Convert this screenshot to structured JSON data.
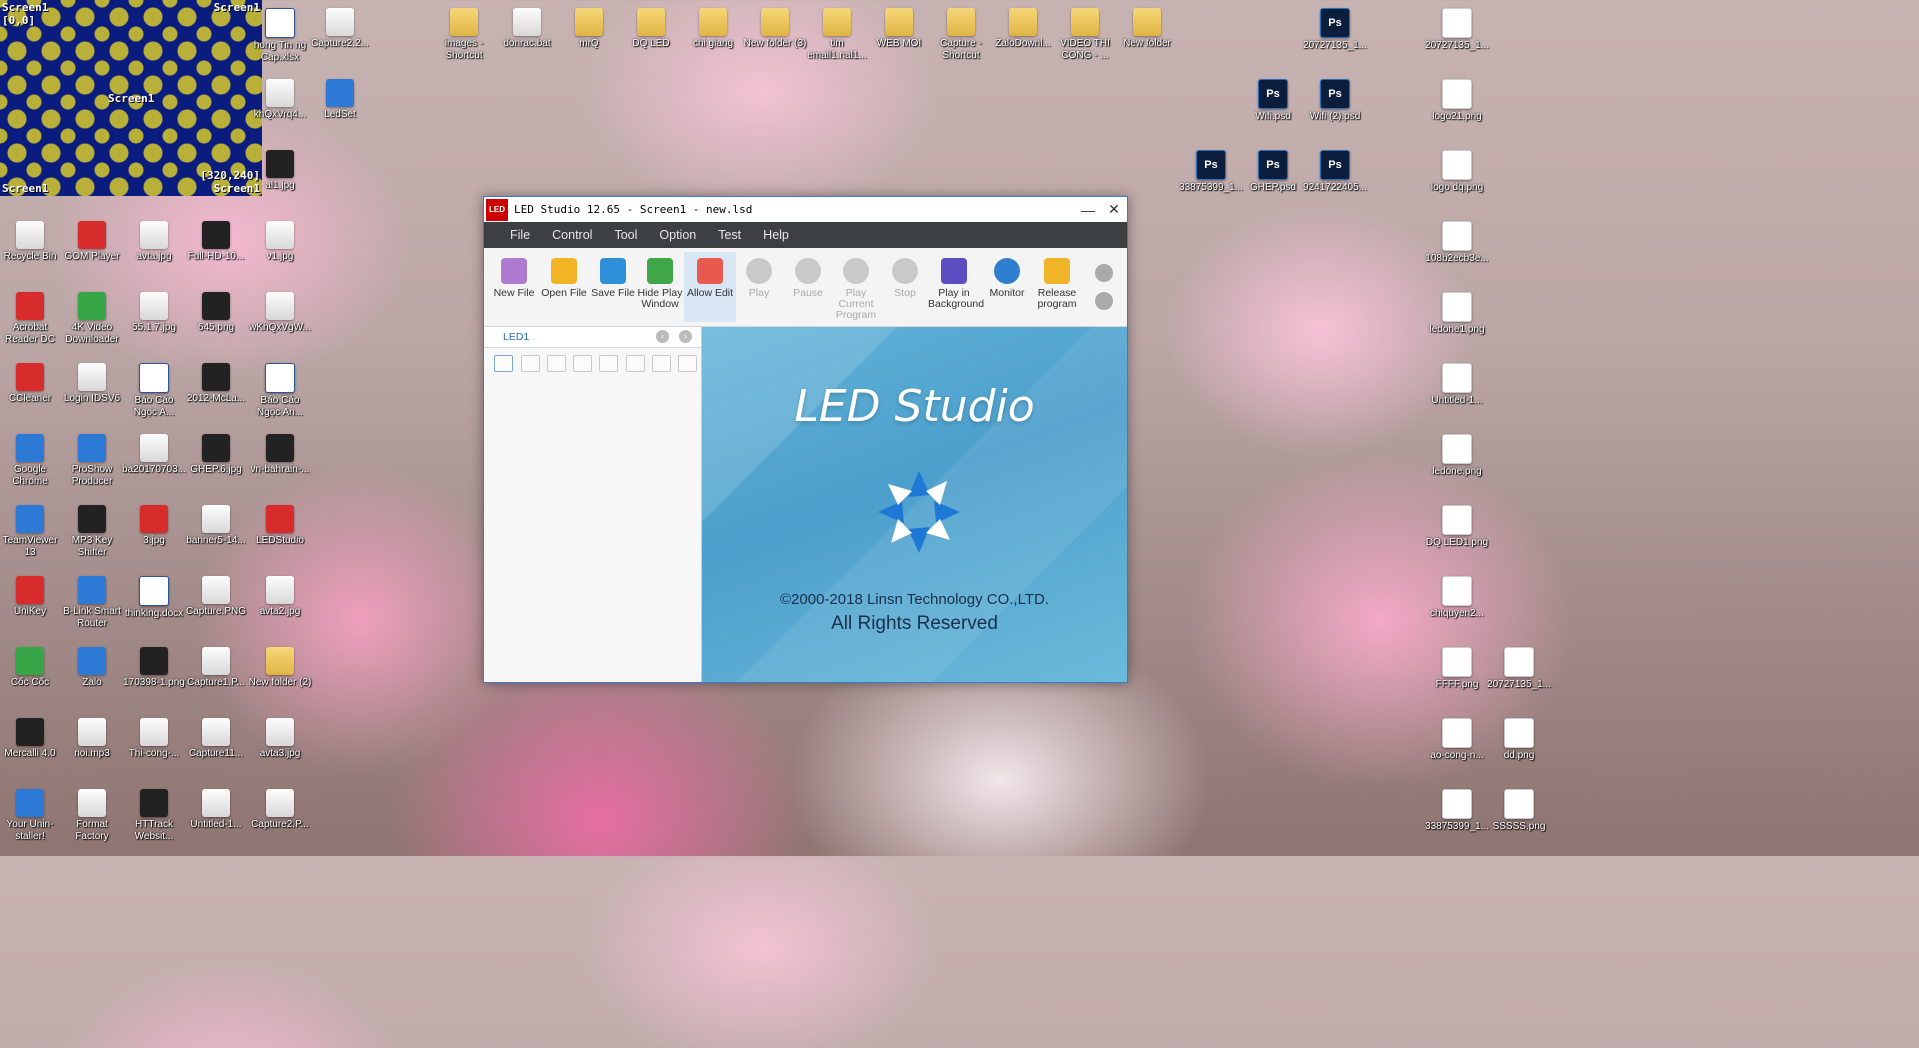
{
  "screen_preview": {
    "top_left": "Screen1",
    "coord_origin": "[0,0]",
    "top_right": "Screen1",
    "center": "Screen1",
    "bottom_left": "Screen1",
    "coord_size": "[320,240]",
    "bottom_right": "Screen1"
  },
  "desktop_icons": [
    {
      "label": "hong Tin ng Cap.xlsx",
      "kind": "doc"
    },
    {
      "label": "Capture2.2...",
      "kind": "img"
    },
    {
      "label": "images - Shortcut",
      "kind": "folder"
    },
    {
      "label": "donrac.bat",
      "kind": "img"
    },
    {
      "label": "mrQ",
      "kind": "folder"
    },
    {
      "label": "DQ LED",
      "kind": "folder"
    },
    {
      "label": "chi giang",
      "kind": "folder"
    },
    {
      "label": "New folder (3)",
      "kind": "folder"
    },
    {
      "label": "tim email1.nal1...",
      "kind": "folder"
    },
    {
      "label": "WEB MOI",
      "kind": "folder"
    },
    {
      "label": "Capture - Shortcut",
      "kind": "folder"
    },
    {
      "label": "ZaloDownl...",
      "kind": "folder"
    },
    {
      "label": "VIDEO THI CONG - ...",
      "kind": "folder"
    },
    {
      "label": "New folder",
      "kind": "folder"
    },
    {
      "label": "20727135_1...",
      "kind": "ps"
    },
    {
      "label": "20727135_1...",
      "kind": "png"
    },
    {
      "label": "khQxVrq4...",
      "kind": "img"
    },
    {
      "label": "LedSet",
      "kind": "app"
    },
    {
      "label": "Wifi.psd",
      "kind": "ps"
    },
    {
      "label": "Wifi (2).psd",
      "kind": "ps"
    },
    {
      "label": "logo21.png",
      "kind": "png"
    },
    {
      "label": "al1.jpg",
      "kind": "dark"
    },
    {
      "label": "33875399_1...",
      "kind": "ps"
    },
    {
      "label": "GHEP.psd",
      "kind": "ps"
    },
    {
      "label": "9241722405...",
      "kind": "ps"
    },
    {
      "label": "logo dq.png",
      "kind": "png"
    },
    {
      "label": "Recycle Bin",
      "kind": "img"
    },
    {
      "label": "GOM Player",
      "kind": "red"
    },
    {
      "label": "avta.jpg",
      "kind": "img"
    },
    {
      "label": "Full-HD-10...",
      "kind": "dark"
    },
    {
      "label": "v1.jpg",
      "kind": "img"
    },
    {
      "label": "108b2ecb3e...",
      "kind": "png"
    },
    {
      "label": "Acrobat Reader DC",
      "kind": "red"
    },
    {
      "label": "4K Video Downloader",
      "kind": "green"
    },
    {
      "label": "55.1.7.jpg",
      "kind": "img"
    },
    {
      "label": "645.png",
      "kind": "dark"
    },
    {
      "label": "wKhQxVgW...",
      "kind": "img"
    },
    {
      "label": "ledone1.png",
      "kind": "png"
    },
    {
      "label": "CCleaner",
      "kind": "red"
    },
    {
      "label": "Login IDSV6",
      "kind": "img"
    },
    {
      "label": "Báo Cáo Ngọc A...",
      "kind": "doc"
    },
    {
      "label": "2012-McLa...",
      "kind": "dark"
    },
    {
      "label": "Báo Cáo Ngọc An...",
      "kind": "doc"
    },
    {
      "label": "Untitled-1...",
      "kind": "png"
    },
    {
      "label": "Google Chrome",
      "kind": "app"
    },
    {
      "label": "ProShow Producer",
      "kind": "app"
    },
    {
      "label": "ba20170703...",
      "kind": "img"
    },
    {
      "label": "GHEP.6.jpg",
      "kind": "dark"
    },
    {
      "label": "vn-bahrain-...",
      "kind": "dark"
    },
    {
      "label": "ledone.png",
      "kind": "png"
    },
    {
      "label": "TeamViewer 13",
      "kind": "app"
    },
    {
      "label": "MP3 Key Shifter",
      "kind": "dark"
    },
    {
      "label": "3.jpg",
      "kind": "red"
    },
    {
      "label": "banner5-14...",
      "kind": "img"
    },
    {
      "label": "LEDStudio",
      "kind": "red"
    },
    {
      "label": "DQ LED1.png",
      "kind": "png"
    },
    {
      "label": "UniKey",
      "kind": "red"
    },
    {
      "label": "B-Link Smart Router",
      "kind": "app"
    },
    {
      "label": "thinking.docx",
      "kind": "doc"
    },
    {
      "label": "Capture.PNG",
      "kind": "img"
    },
    {
      "label": "avta2.jpg",
      "kind": "img"
    },
    {
      "label": "chiquyen2...",
      "kind": "png"
    },
    {
      "label": "Cốc Cốc",
      "kind": "green"
    },
    {
      "label": "Zalo",
      "kind": "app"
    },
    {
      "label": "170398-1.png",
      "kind": "dark"
    },
    {
      "label": "Capture1.P...",
      "kind": "img"
    },
    {
      "label": "New folder (2)",
      "kind": "folder"
    },
    {
      "label": "FFFF.png",
      "kind": "png"
    },
    {
      "label": "20727135_1...",
      "kind": "png"
    },
    {
      "label": "Mercalli 4.0",
      "kind": "dark"
    },
    {
      "label": "noi.mp3",
      "kind": "img"
    },
    {
      "label": "Thi-cong-...",
      "kind": "img"
    },
    {
      "label": "Capture11...",
      "kind": "img"
    },
    {
      "label": "avta3.jpg",
      "kind": "img"
    },
    {
      "label": "ao-cong-n...",
      "kind": "png"
    },
    {
      "label": "dd.png",
      "kind": "png"
    },
    {
      "label": "Your Unin-staller!",
      "kind": "app"
    },
    {
      "label": "Format Factory",
      "kind": "img"
    },
    {
      "label": "HTTrack Websit...",
      "kind": "dark"
    },
    {
      "label": "Untitled-1...",
      "kind": "img"
    },
    {
      "label": "Capture2.P...",
      "kind": "img"
    },
    {
      "label": "33875399_1...",
      "kind": "png"
    },
    {
      "label": "SSSSS.png",
      "kind": "png"
    }
  ],
  "window": {
    "logo_text": "LED",
    "title": "LED Studio 12.65 - Screen1 - new.lsd",
    "minimize": "—",
    "close": "✕",
    "menu": [
      "File",
      "Control",
      "Tool",
      "Option",
      "Test",
      "Help"
    ],
    "toolbar": [
      {
        "label": "New File",
        "color": "#b07ad0",
        "state": "normal"
      },
      {
        "label": "Open File",
        "color": "#f2b325",
        "state": "normal"
      },
      {
        "label": "Save File",
        "color": "#2f8fd8",
        "state": "normal"
      },
      {
        "label": "Hide Play Window",
        "color": "#3fa64a",
        "state": "normal"
      },
      {
        "label": "Allow Edit",
        "color": "#e85a4f",
        "state": "active"
      },
      {
        "label": "Play",
        "color": "#c9c9c9",
        "state": "disabled"
      },
      {
        "label": "Pause",
        "color": "#c9c9c9",
        "state": "disabled"
      },
      {
        "label": "Play Current Program",
        "color": "#c9c9c9",
        "state": "disabled"
      },
      {
        "label": "Stop",
        "color": "#c9c9c9",
        "state": "disabled"
      },
      {
        "label": "Play in Background",
        "color": "#5b4ec2",
        "state": "normal"
      },
      {
        "label": "Monitor",
        "color": "#2f7fd0",
        "state": "normal"
      },
      {
        "label": "Release program",
        "color": "#f0b428",
        "state": "normal"
      }
    ],
    "left_tab": "LED1",
    "splash_title": "LED Studio",
    "splash_copyright": "©2000-2018 Linsn Technology CO.,LTD.",
    "splash_rights": "All Rights Reserved"
  }
}
